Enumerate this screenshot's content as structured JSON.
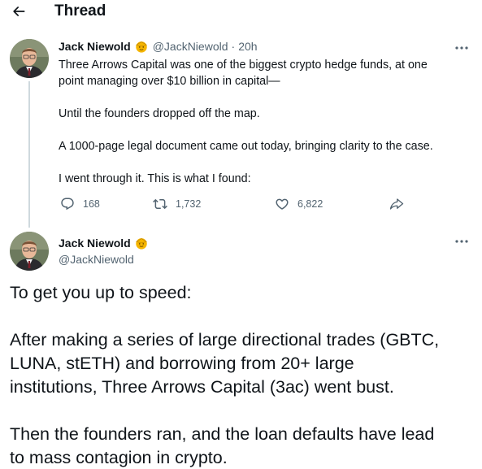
{
  "header": {
    "title": "Thread",
    "back_icon": "arrow-left-icon"
  },
  "tweet1": {
    "display_name": "Jack Niewold",
    "badge_icon": "emoji-badge-icon",
    "handle": "@JackNiewold",
    "separator": "·",
    "time": "20h",
    "lines": [
      "Three Arrows Capital was one of the biggest crypto hedge funds, at one",
      "point managing over $10 billion in capital—",
      "Until the founders dropped off the map.",
      "A 1000-page legal document came out today, bringing clarity to the case.",
      "I went through it. This is what I found:"
    ],
    "actions": {
      "replies": "168",
      "retweets": "1,732",
      "likes": "6,822"
    }
  },
  "tweet2": {
    "display_name": "Jack Niewold",
    "badge_icon": "emoji-badge-icon",
    "handle": "@JackNiewold",
    "lines": [
      "To get you up to speed:",
      "After making a series of large directional trades (GBTC,",
      "LUNA, stETH) and borrowing from 20+ large",
      "institutions, Three Arrows Capital (3ac) went bust.",
      "Then the founders ran, and the loan defaults have lead",
      "to mass contagion in crypto."
    ]
  },
  "colors": {
    "text": "#0f1419",
    "secondary": "#536471",
    "thread_line": "#cfd9de",
    "badge": "#f5b500"
  }
}
